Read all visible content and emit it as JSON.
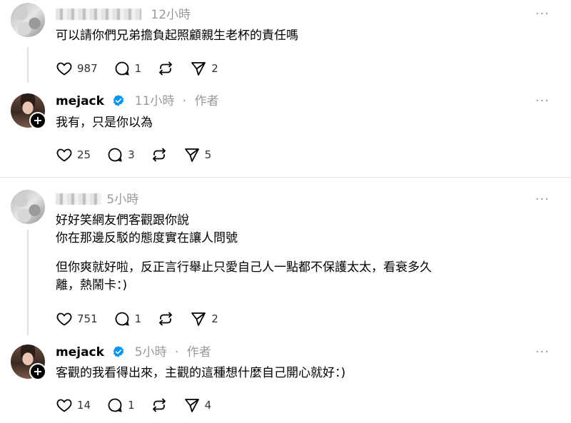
{
  "posts": [
    {
      "type": "reply",
      "meta": "12小時",
      "text": [
        "可以請你們兄弟擔負起照顧親生老杯的責任嗎"
      ],
      "likes": "987",
      "replies": "1",
      "reposts": "",
      "shares": "2"
    },
    {
      "type": "author",
      "username": "mejack",
      "meta": "11小時",
      "role": "作者",
      "text": [
        "我有，只是你以為"
      ],
      "likes": "25",
      "replies": "3",
      "reposts": "",
      "shares": "5"
    },
    {
      "type": "reply",
      "meta": "5小時",
      "text": [
        "好好笑網友們客觀跟你說",
        "你在那邊反駁的態度實在讓人問號",
        "",
        "但你爽就好啦，反正言行舉止只愛自己人一點都不保護太太，看衰多久",
        "離，熱鬧卡：)"
      ],
      "likes": "751",
      "replies": "1",
      "reposts": "",
      "shares": "2"
    },
    {
      "type": "author",
      "username": "mejack",
      "meta": "5小時",
      "role": "作者",
      "text": [
        "客觀的我看得出來，主觀的這種想什麼自己開心就好：)"
      ],
      "likes": "14",
      "replies": "1",
      "reposts": "",
      "shares": "4"
    }
  ],
  "more_label": "···",
  "colors": {
    "verified": "#0095f6",
    "meta": "#999999",
    "divider": "#e2e2e2"
  }
}
